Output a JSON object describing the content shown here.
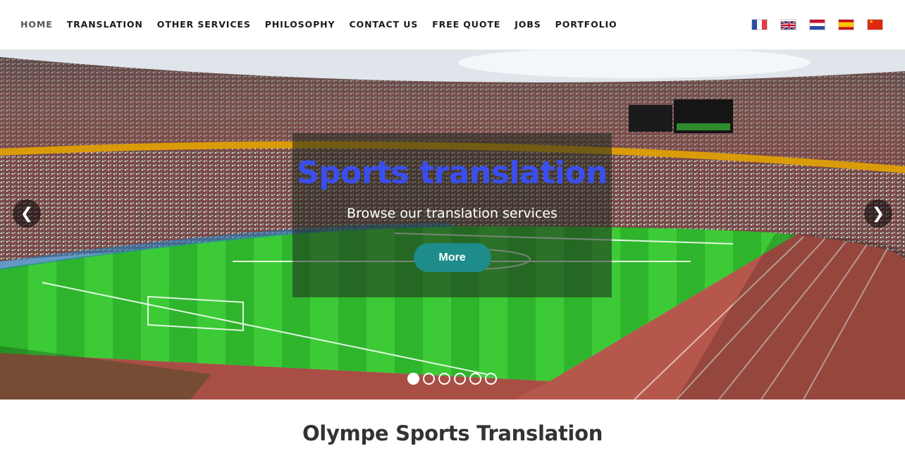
{
  "nav": {
    "items": [
      {
        "label": "HOME"
      },
      {
        "label": "TRANSLATION"
      },
      {
        "label": "OTHER SERVICES"
      },
      {
        "label": "PHILOSOPHY"
      },
      {
        "label": "CONTACT US"
      },
      {
        "label": "FREE QUOTE"
      },
      {
        "label": "JOBS"
      },
      {
        "label": "PORTFOLIO"
      }
    ],
    "active_index": 0
  },
  "languages": [
    {
      "icon": "flag-france-icon"
    },
    {
      "icon": "flag-uk-icon"
    },
    {
      "icon": "flag-netherlands-icon"
    },
    {
      "icon": "flag-spain-icon"
    },
    {
      "icon": "flag-china-icon"
    }
  ],
  "hero": {
    "title": "Sports translation",
    "subtitle": "Browse our translation services",
    "button_label": "More",
    "prev_icon": "chevron-left-icon",
    "next_icon": "chevron-right-icon",
    "slide_count": 6,
    "active_slide": 1,
    "image": "stadium-photo",
    "colors": {
      "title": "#3a4ef0",
      "button": "#1d8c8a"
    }
  },
  "section": {
    "title": "Olympe Sports Translation"
  }
}
